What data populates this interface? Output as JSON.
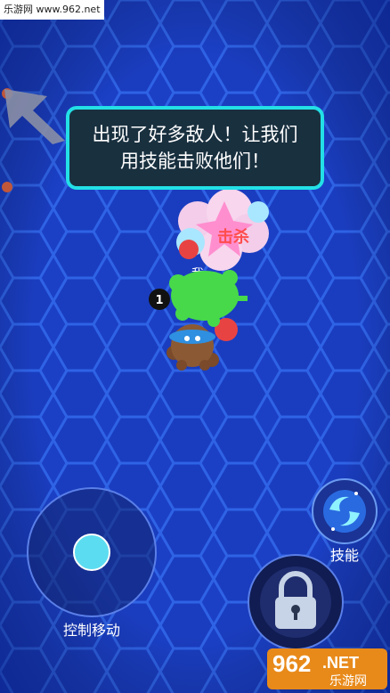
{
  "watermark_top": "乐游网 www.962.net",
  "tip": {
    "line1": "出现了好多敌人！让我们",
    "line2": "用技能击败他们！"
  },
  "kill_text": "击杀",
  "player_level": "1",
  "enemy_name_partial": "我",
  "controls": {
    "joystick_label": "控制移动",
    "skill_label": "技能"
  },
  "watermark_bottom": {
    "number": "962",
    "suffix": ".NET",
    "site": "乐游网"
  },
  "icons": [
    "joystick-knob-icon",
    "skill-swirl-icon",
    "lock-icon",
    "pointer-arrow-icon"
  ]
}
